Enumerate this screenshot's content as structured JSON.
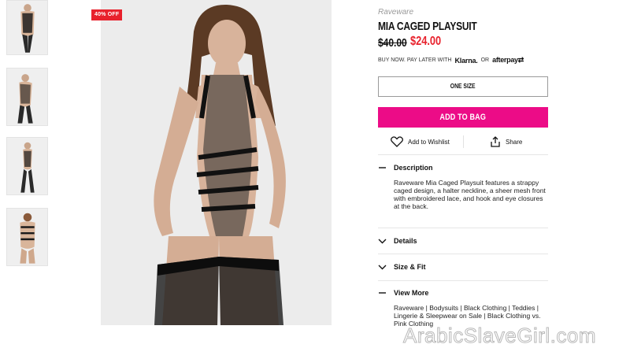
{
  "badge": {
    "label": "40% OFF",
    "color": "#e8212c"
  },
  "product": {
    "brand": "Raveware",
    "title": "MIA CAGED PLAYSUIT",
    "price_original": "$40.00",
    "price_sale": "$24.00"
  },
  "bnpl": {
    "text": "BUY NOW. PAY LATER WITH",
    "klarna": "Klarna.",
    "or": "OR",
    "afterpay": "afterpay"
  },
  "size": {
    "label": "ONE SIZE"
  },
  "cart": {
    "label": "ADD TO BAG",
    "color": "#ec0c87"
  },
  "actions": {
    "wishlist": "Add to Wishlist",
    "share": "Share"
  },
  "accordions": {
    "description": {
      "title": "Description",
      "body": "Raveware Mia Caged Playsuit features a strappy caged design, a halter neckline, a sheer mesh front with embroidered lace, and hook and eye closures at the back."
    },
    "details": {
      "title": "Details"
    },
    "size_fit": {
      "title": "Size & Fit"
    },
    "view_more": {
      "title": "View More",
      "body": "Raveware | Bodysuits | Black Clothing | Teddies | Lingerie & Sleepwear on Sale | Black Clothing vs. Pink Clothing"
    }
  },
  "watermark": "ArabicSlaveGirl.com",
  "icons": [
    "heart-icon",
    "share-icon",
    "minus-icon",
    "chevron-down-icon"
  ]
}
